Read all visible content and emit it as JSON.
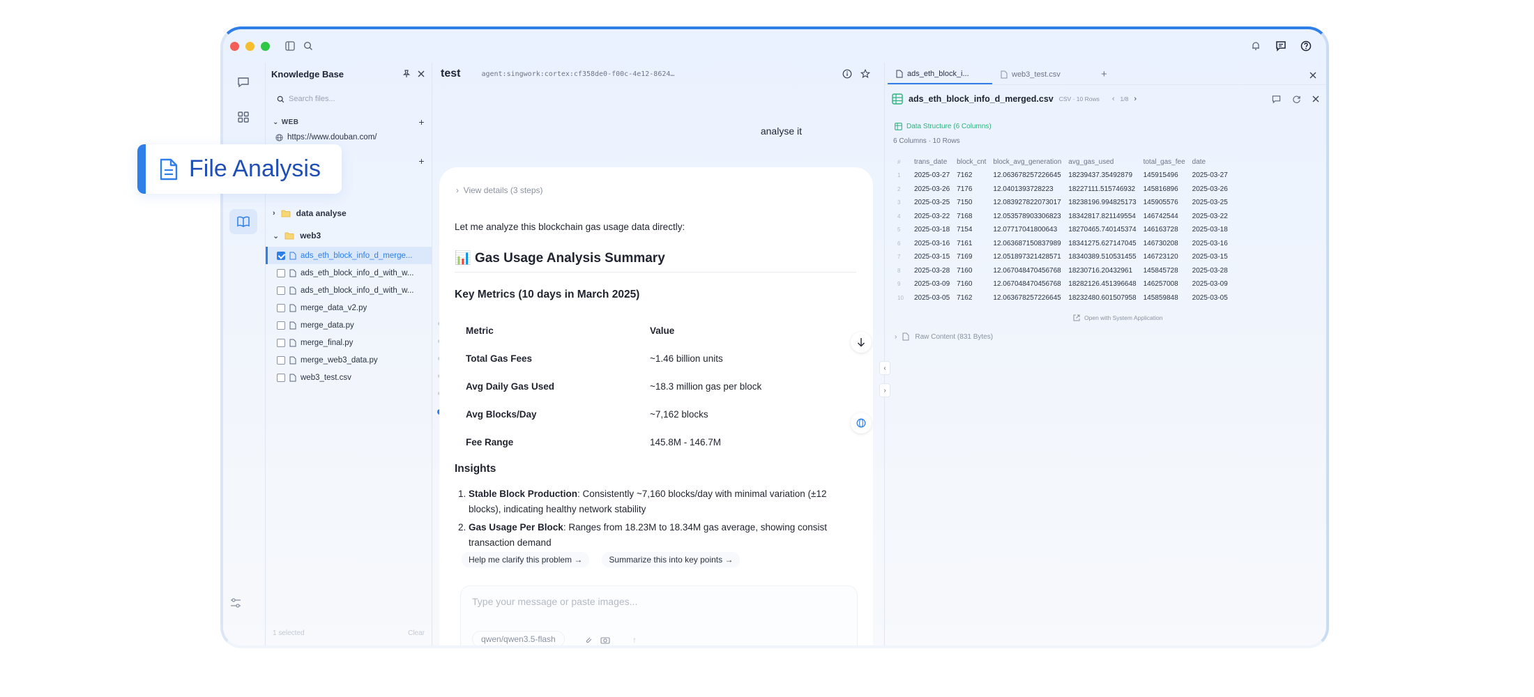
{
  "callout": {
    "label": "File Analysis"
  },
  "kb": {
    "title": "Knowledge Base",
    "search_placeholder": "Search files...",
    "web_section": "WEB",
    "web_link": "https://www.douban.com/",
    "folders": [
      {
        "name": "data analyse"
      },
      {
        "name": "web3"
      }
    ],
    "files": [
      {
        "name": "ads_eth_block_info_d_merge...",
        "selected": true
      },
      {
        "name": "ads_eth_block_info_d_with_w...",
        "selected": false
      },
      {
        "name": "ads_eth_block_info_d_with_w...",
        "selected": false
      },
      {
        "name": "merge_data_v2.py",
        "selected": false
      },
      {
        "name": "merge_data.py",
        "selected": false
      },
      {
        "name": "merge_final.py",
        "selected": false
      },
      {
        "name": "merge_web3_data.py",
        "selected": false
      },
      {
        "name": "web3_test.csv",
        "selected": false
      }
    ],
    "footer_left": "1 selected",
    "footer_right": "Clear"
  },
  "chat": {
    "title": "test",
    "agent_id": "agent:singwork:cortex:cf358de0-f00c-4e12-8624…",
    "user_message": "analyse it",
    "view_details": "View details (3 steps)",
    "intro": "Let me analyze this blockchain gas usage data directly:",
    "heading": "Gas Usage Analysis Summary",
    "heading_emoji": "📊",
    "key_metrics_heading": "Key Metrics (10 days in March 2025)",
    "table_headers": [
      "Metric",
      "Value"
    ],
    "table_rows": [
      [
        "Total Gas Fees",
        "~1.46 billion units"
      ],
      [
        "Avg Daily Gas Used",
        "~18.3 million gas per block"
      ],
      [
        "Avg Blocks/Day",
        "~7,162 blocks"
      ],
      [
        "Fee Range",
        "145.8M - 146.7M"
      ]
    ],
    "insights_heading": "Insights",
    "insights": [
      {
        "bold": "Stable Block Production",
        "text": ": Consistently ~7,160 blocks/day with minimal variation (±12 blocks), indicating healthy network stability"
      },
      {
        "bold": "Gas Usage Per Block",
        "text": ": Ranges from 18.23M to 18.34M gas average, showing consist transaction demand"
      }
    ],
    "suggestions": [
      "Help me clarify this problem →",
      "Summarize this into key points →"
    ],
    "composer_placeholder": "Type your message or paste images...",
    "model": "qwen/qwen3.5-flash"
  },
  "right": {
    "tabs": [
      "ads_eth_block_i...",
      "web3_test.csv"
    ],
    "file_name": "ads_eth_block_info_d_merged.csv",
    "file_meta": "CSV · 10 Rows",
    "page": "1/8",
    "ds_label": "Data Structure (6 Columns)",
    "ds_sub": "6 Columns · 10 Rows",
    "columns": [
      "#",
      "trans_date",
      "block_cnt",
      "block_avg_generation",
      "avg_gas_used",
      "total_gas_fee",
      "date"
    ],
    "rows": [
      [
        "1",
        "2025-03-27",
        "7162",
        "12.063678257226645",
        "18239437.35492879",
        "145915496",
        "2025-03-27"
      ],
      [
        "2",
        "2025-03-26",
        "7176",
        "12.0401393728223",
        "18227111.515746932",
        "145816896",
        "2025-03-26"
      ],
      [
        "3",
        "2025-03-25",
        "7150",
        "12.083927822073017",
        "18238196.994825173",
        "145905576",
        "2025-03-25"
      ],
      [
        "4",
        "2025-03-22",
        "7168",
        "12.053578903306823",
        "18342817.821149554",
        "146742544",
        "2025-03-22"
      ],
      [
        "5",
        "2025-03-18",
        "7154",
        "12.07717041800643",
        "18270465.740145374",
        "146163728",
        "2025-03-18"
      ],
      [
        "6",
        "2025-03-16",
        "7161",
        "12.063687150837989",
        "18341275.627147045",
        "146730208",
        "2025-03-16"
      ],
      [
        "7",
        "2025-03-15",
        "7169",
        "12.051897321428571",
        "18340389.510531455",
        "146723120",
        "2025-03-15"
      ],
      [
        "8",
        "2025-03-28",
        "7160",
        "12.067048470456768",
        "18230716.20432961",
        "145845728",
        "2025-03-28"
      ],
      [
        "9",
        "2025-03-09",
        "7160",
        "12.067048470456768",
        "18282126.451396648",
        "146257008",
        "2025-03-09"
      ],
      [
        "10",
        "2025-03-05",
        "7162",
        "12.063678257226645",
        "18232480.601507958",
        "145859848",
        "2025-03-05"
      ]
    ],
    "open_system": "Open with System Application",
    "raw_content": "Raw Content (831 Bytes)"
  },
  "colors": {
    "accent": "#2f7fe9",
    "success": "#2bb37c"
  }
}
